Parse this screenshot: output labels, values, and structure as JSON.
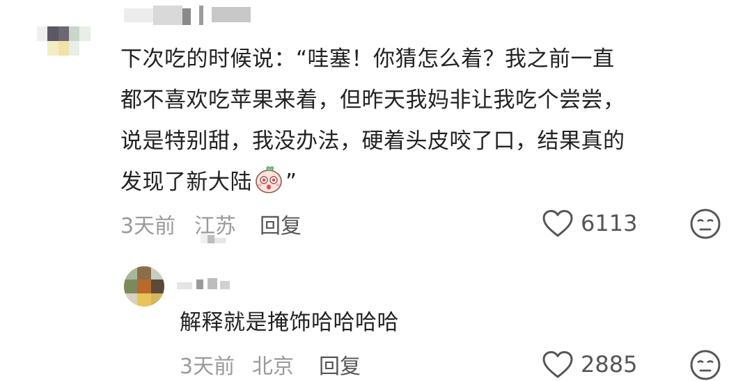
{
  "comment": {
    "text_before_emoji": "下次吃的时候说：“哇塞！你猜怎么着？我之前一直\n都不喜欢吃苹果来着，但昨天我妈非让我吃个尝尝，\n说是特别甜，我没办法，硬着头皮咬了口，结果真的\n发现了新大陆",
    "text_after_emoji": "”",
    "emoji": "surprised-peach-face",
    "time": "3天前",
    "location": "江苏",
    "reply_label": "回复",
    "like_count": "6113"
  },
  "reply": {
    "text": "解释就是掩饰哈哈哈哈",
    "time": "3天前",
    "location": "北京",
    "reply_label": "回复",
    "like_count": "2885"
  },
  "icons": {
    "like": "heart-outline-icon",
    "dislike": "meh-face-icon"
  },
  "colors": {
    "text_primary": "#222222",
    "text_secondary": "#9a9a9a",
    "icon": "#555555"
  }
}
